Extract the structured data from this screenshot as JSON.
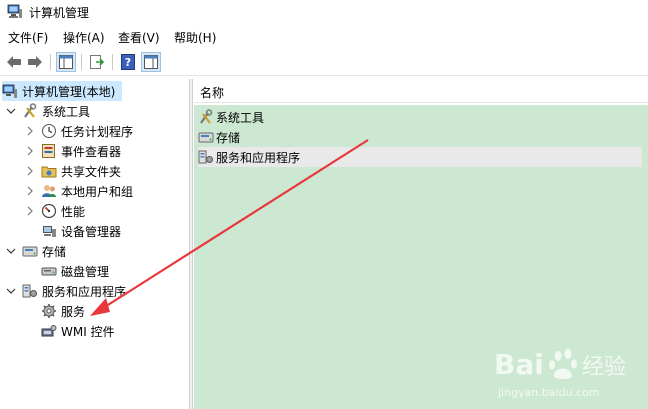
{
  "window": {
    "title": "计算机管理"
  },
  "menu": {
    "items": [
      "文件(F)",
      "操作(A)",
      "查看(V)",
      "帮助(H)"
    ]
  },
  "tree": {
    "root_label": "计算机管理(本地)",
    "nodes": [
      {
        "label": "系统工具",
        "icon": "tools-icon"
      },
      {
        "label": "任务计划程序",
        "icon": "clock-icon"
      },
      {
        "label": "事件查看器",
        "icon": "event-viewer-icon"
      },
      {
        "label": "共享文件夹",
        "icon": "shared-folder-icon"
      },
      {
        "label": "本地用户和组",
        "icon": "users-icon"
      },
      {
        "label": "性能",
        "icon": "performance-icon"
      },
      {
        "label": "设备管理器",
        "icon": "device-manager-icon"
      },
      {
        "label": "存储",
        "icon": "storage-icon"
      },
      {
        "label": "磁盘管理",
        "icon": "disk-icon"
      },
      {
        "label": "服务和应用程序",
        "icon": "services-apps-icon"
      },
      {
        "label": "服务",
        "icon": "gear-icon"
      },
      {
        "label": "WMI 控件",
        "icon": "wmi-icon"
      }
    ]
  },
  "list": {
    "header": "名称",
    "rows": [
      "系统工具",
      "存储",
      "服务和应用程序"
    ]
  },
  "watermark": {
    "brand": "Bai",
    "brand2": "经验",
    "url": "jingyan.baidu.com"
  },
  "colors": {
    "selection": "#cce8ff",
    "list_bg": "#cde8d2",
    "arrow": "#e8383b"
  }
}
